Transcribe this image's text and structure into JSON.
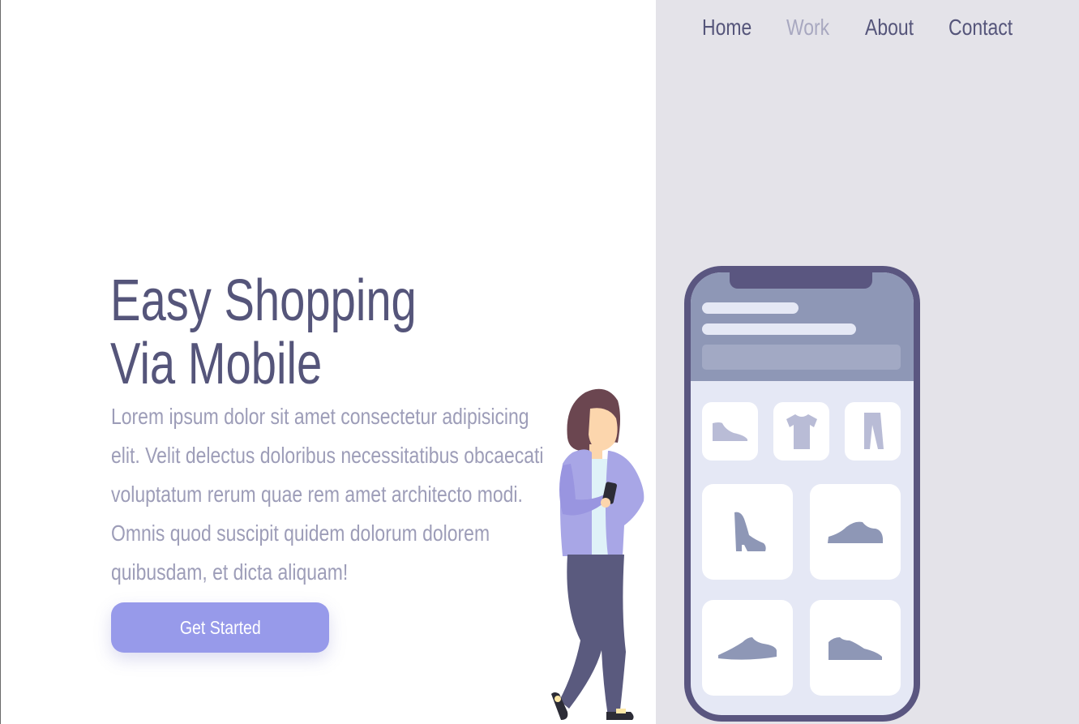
{
  "nav": {
    "items": [
      {
        "label": "Home",
        "active": false
      },
      {
        "label": "Work",
        "active": true
      },
      {
        "label": "About",
        "active": false
      },
      {
        "label": "Contact",
        "active": false
      }
    ]
  },
  "hero": {
    "title_line1": "Easy Shopping",
    "title_line2": "Via Mobile",
    "description": "Lorem ipsum dolor sit amet consectetur adipisicing elit. Velit delectus doloribus necessitatibus obcaecati voluptatum rerum quae rem amet architecto modi. Omnis quod suscipit quidem dolorum dolorem quibusdam, et dicta aliquam!",
    "cta_label": "Get Started"
  },
  "colors": {
    "primary_text": "#55557a",
    "muted_text": "#9d9db8",
    "active_nav": "#a8a8c0",
    "accent": "#979aea",
    "panel_bg": "#e4e3e9"
  },
  "illustration": {
    "phone_icons": [
      "flat-shoe-icon",
      "tshirt-icon",
      "pants-icon",
      "boot-icon",
      "sneaker-icon",
      "running-shoe-icon",
      "low-sneaker-icon"
    ],
    "figure": "woman-holding-phone"
  }
}
